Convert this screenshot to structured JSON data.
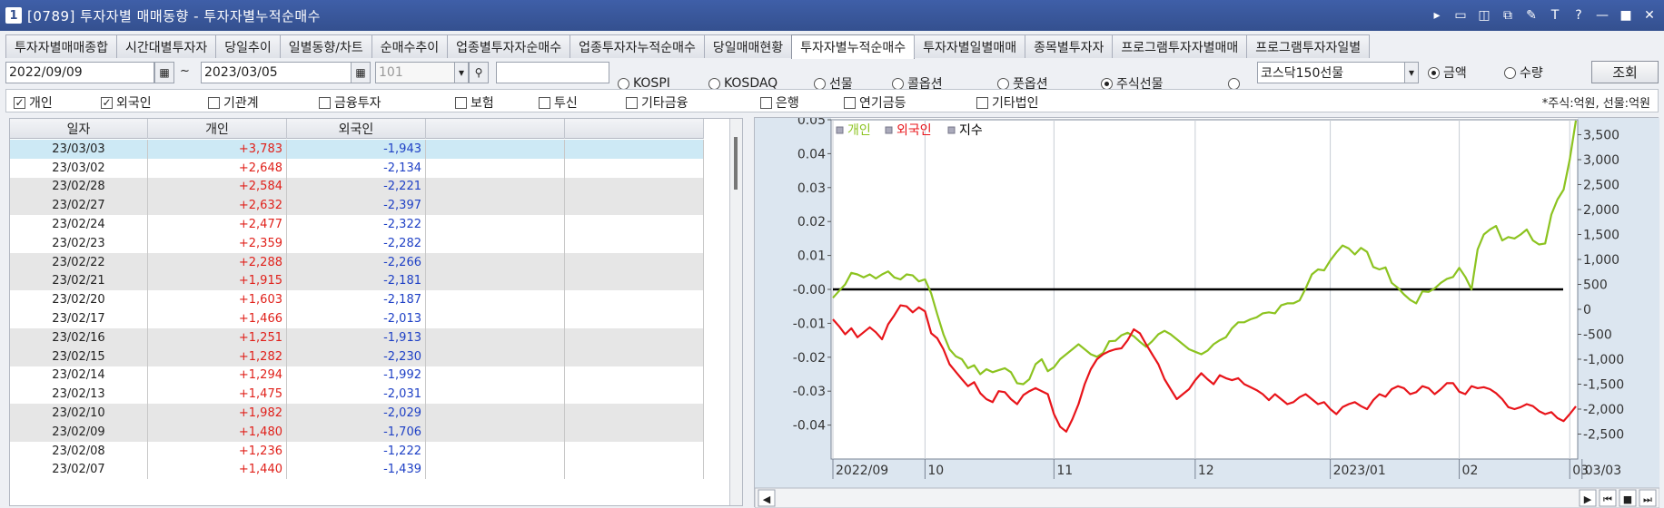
{
  "window": {
    "number": "1",
    "title": "[0789] 투자자별 매매동향 - 투자자별누적순매수",
    "icons": [
      "arrow-right-icon",
      "screen-icon",
      "layout-icon",
      "window-icon",
      "paint-icon",
      "font-icon",
      "help-icon",
      "minimize-icon",
      "maximize-icon",
      "close-icon"
    ],
    "tool_glyphs": [
      "▸",
      "▭",
      "◫",
      "⧉",
      "✎",
      "T",
      "?",
      "—",
      "■",
      "✕"
    ]
  },
  "tabs": [
    {
      "label": "투자자별매매종합",
      "active": false
    },
    {
      "label": "시간대별투자자",
      "active": false
    },
    {
      "label": "당일추이",
      "active": false
    },
    {
      "label": "일별동향/차트",
      "active": false
    },
    {
      "label": "순매수추이",
      "active": false
    },
    {
      "label": "업종별투자자순매수",
      "active": false
    },
    {
      "label": "업종투자자누적순매수",
      "active": false
    },
    {
      "label": "당일매매현황",
      "active": false
    },
    {
      "label": "투자자별누적순매수",
      "active": true
    },
    {
      "label": "투자자별일별매매",
      "active": false
    },
    {
      "label": "종목별투자자",
      "active": false
    },
    {
      "label": "프로그램투자자별매매",
      "active": false
    },
    {
      "label": "프로그램투자자일별",
      "active": false
    }
  ],
  "controls": {
    "start_date": "2022/09/09",
    "tilde": "~",
    "end_date": "2023/03/05",
    "code": "101",
    "code_input": "",
    "markets": [
      {
        "label": "KOSPI",
        "checked": false
      },
      {
        "label": "KOSDAQ",
        "checked": false
      },
      {
        "label": "선물",
        "checked": false
      },
      {
        "label": "콜옵션",
        "checked": false
      },
      {
        "label": "풋옵션",
        "checked": false
      },
      {
        "label": "주식선물",
        "checked": true
      },
      {
        "label": "",
        "checked": false
      }
    ],
    "futures_select": "코스닥150선물",
    "amount_radio": {
      "label": "금액",
      "checked": true
    },
    "qty_radio": {
      "label": "수량",
      "checked": false
    },
    "search_button": "조회"
  },
  "checkboxes": [
    {
      "label": "개인",
      "checked": true
    },
    {
      "label": "외국인",
      "checked": true
    },
    {
      "label": "기관계",
      "checked": false
    },
    {
      "label": "금융투자",
      "checked": false
    },
    {
      "label": "보험",
      "checked": false
    },
    {
      "label": "투신",
      "checked": false
    },
    {
      "label": "기타금융",
      "checked": false
    },
    {
      "label": "은행",
      "checked": false
    },
    {
      "label": "연기금등",
      "checked": false
    },
    {
      "label": "기타법인",
      "checked": false
    }
  ],
  "unit_note": "*주식:억원, 선물:억원",
  "table": {
    "columns": [
      "일자",
      "개인",
      "외국인",
      "",
      ""
    ],
    "rows": [
      [
        "23/03/03",
        "+3,783",
        "-1,943"
      ],
      [
        "23/03/02",
        "+2,648",
        "-2,134"
      ],
      [
        "23/02/28",
        "+2,584",
        "-2,221"
      ],
      [
        "23/02/27",
        "+2,632",
        "-2,397"
      ],
      [
        "23/02/24",
        "+2,477",
        "-2,322"
      ],
      [
        "23/02/23",
        "+2,359",
        "-2,282"
      ],
      [
        "23/02/22",
        "+2,288",
        "-2,266"
      ],
      [
        "23/02/21",
        "+1,915",
        "-2,181"
      ],
      [
        "23/02/20",
        "+1,603",
        "-2,187"
      ],
      [
        "23/02/17",
        "+1,466",
        "-2,013"
      ],
      [
        "23/02/16",
        "+1,251",
        "-1,913"
      ],
      [
        "23/02/15",
        "+1,282",
        "-2,230"
      ],
      [
        "23/02/14",
        "+1,294",
        "-1,992"
      ],
      [
        "23/02/13",
        "+1,475",
        "-2,031"
      ],
      [
        "23/02/10",
        "+1,982",
        "-2,029"
      ],
      [
        "23/02/09",
        "+1,480",
        "-1,706"
      ],
      [
        "23/02/08",
        "+1,236",
        "-1,222"
      ],
      [
        "23/02/07",
        "+1,440",
        "-1,439"
      ]
    ]
  },
  "chart_data": {
    "type": "line",
    "legend": [
      "개인",
      "외국인",
      "지수"
    ],
    "colors": {
      "개인": "#8cc320",
      "외국인": "#e8141a",
      "지수": "#000000"
    },
    "left_axis": {
      "ticks": [
        "0.05",
        "0.04",
        "0.03",
        "0.02",
        "0.01",
        "-0.00",
        "-0.01",
        "-0.02",
        "-0.03",
        "-0.04"
      ],
      "range": [
        -0.05,
        0.05
      ]
    },
    "right_axis": {
      "ticks": [
        "3,500",
        "3,000",
        "2,500",
        "2,000",
        "1,500",
        "1,000",
        "500",
        "0",
        "-500",
        "-1,000",
        "-1,500",
        "-2,000",
        "-2,500"
      ],
      "range": [
        -3000,
        3800
      ]
    },
    "x_labels": [
      "2022/09",
      "10",
      "11",
      "12",
      "2023/01",
      "02",
      "03",
      "03/03"
    ],
    "x_label_index": [
      0,
      15,
      36,
      59,
      81,
      102,
      120,
      122
    ],
    "series": [
      {
        "name": "개인",
        "axis": "right",
        "values": [
          230,
          370,
          500,
          730,
          700,
          640,
          700,
          620,
          700,
          760,
          640,
          600,
          700,
          680,
          560,
          600,
          320,
          -100,
          -500,
          -800,
          -940,
          -1000,
          -1180,
          -1120,
          -1300,
          -1200,
          -1260,
          -1220,
          -1180,
          -1260,
          -1480,
          -1500,
          -1400,
          -1100,
          -1000,
          -1240,
          -1160,
          -1000,
          -900,
          -800,
          -700,
          -800,
          -900,
          -950,
          -870,
          -640,
          -630,
          -520,
          -470,
          -540,
          -650,
          -750,
          -640,
          -500,
          -430,
          -500,
          -600,
          -700,
          -800,
          -850,
          -900,
          -830,
          -700,
          -620,
          -560,
          -380,
          -260,
          -260,
          -200,
          -160,
          -80,
          -60,
          -80,
          80,
          120,
          120,
          180,
          420,
          700,
          800,
          780,
          980,
          1140,
          1280,
          1220,
          1100,
          1230,
          1150,
          850,
          800,
          840,
          530,
          430,
          300,
          190,
          120,
          360,
          350,
          420,
          530,
          610,
          650,
          830,
          650,
          400,
          1200,
          1500,
          1600,
          1670,
          1380,
          1450,
          1420,
          1500,
          1600,
          1380,
          1300,
          1320,
          1900,
          2200,
          2400,
          3000,
          3783
        ]
      },
      {
        "name": "외국인",
        "axis": "right",
        "values": [
          -200,
          -340,
          -500,
          -380,
          -560,
          -460,
          -360,
          -460,
          -600,
          -300,
          -120,
          80,
          60,
          -60,
          40,
          -40,
          -480,
          -580,
          -800,
          -1100,
          -1250,
          -1400,
          -1540,
          -1460,
          -1680,
          -1800,
          -1860,
          -1640,
          -1660,
          -1800,
          -1900,
          -1720,
          -1640,
          -1580,
          -1640,
          -1700,
          -2100,
          -2350,
          -2450,
          -2200,
          -1900,
          -1500,
          -1200,
          -1000,
          -900,
          -840,
          -800,
          -780,
          -620,
          -400,
          -480,
          -700,
          -900,
          -1100,
          -1400,
          -1600,
          -1800,
          -1700,
          -1600,
          -1420,
          -1280,
          -1400,
          -1500,
          -1320,
          -1380,
          -1420,
          -1380,
          -1500,
          -1560,
          -1620,
          -1700,
          -1820,
          -1700,
          -1800,
          -1900,
          -1860,
          -1760,
          -1700,
          -1800,
          -1900,
          -1860,
          -2000,
          -2100,
          -1960,
          -1900,
          -1860,
          -1940,
          -2000,
          -1820,
          -1700,
          -1750,
          -1600,
          -1540,
          -1580,
          -1700,
          -1660,
          -1540,
          -1580,
          -1700,
          -1600,
          -1480,
          -1480,
          -1650,
          -1700,
          -1540,
          -1580,
          -1560,
          -1600,
          -1680,
          -1800,
          -1960,
          -2000,
          -1960,
          -1900,
          -1940,
          -2040,
          -2100,
          -2060,
          -2180,
          -2240,
          -2100,
          -1943
        ]
      },
      {
        "name": "지수",
        "axis": "left",
        "values": [
          0,
          0
        ]
      }
    ]
  },
  "bottom_nav": [
    "◀",
    "▶",
    "⏮",
    "■",
    "⏭"
  ]
}
